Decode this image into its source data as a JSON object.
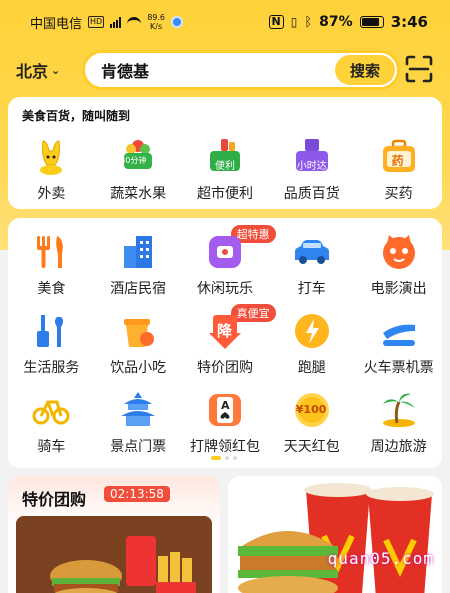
{
  "status_bar": {
    "carrier": "中国电信",
    "hd_badge": "HD",
    "net_speed_value": "89.6",
    "net_speed_unit": "K/s",
    "battery_percent": "87%",
    "battery_level": 0.87,
    "time": "3:46"
  },
  "search": {
    "city": "北京",
    "query": "肯德基",
    "button_label": "搜索"
  },
  "quick_services": {
    "slogan": "美食百货，随叫随到",
    "items": [
      {
        "label": "外卖",
        "icon": "waimai-mascot-icon"
      },
      {
        "label": "蔬菜水果",
        "icon": "vegetable-basket-icon",
        "badge": "30分钟"
      },
      {
        "label": "超市便利",
        "icon": "supermarket-basket-icon",
        "badge": "便利"
      },
      {
        "label": "品质百货",
        "icon": "quality-goods-icon",
        "badge": "小时达"
      },
      {
        "label": "买药",
        "icon": "medicine-box-icon",
        "badge": "药"
      }
    ]
  },
  "services_grid": {
    "rows": [
      [
        {
          "label": "美食",
          "icon": "food-utensils-icon"
        },
        {
          "label": "酒店民宿",
          "icon": "hotel-building-icon"
        },
        {
          "label": "休闲玩乐",
          "icon": "leisure-fun-icon",
          "tag": "超特惠"
        },
        {
          "label": "打车",
          "icon": "taxi-car-icon"
        },
        {
          "label": "电影演出",
          "icon": "movie-cat-icon"
        }
      ],
      [
        {
          "label": "生活服务",
          "icon": "life-service-tools-icon"
        },
        {
          "label": "饮品小吃",
          "icon": "drink-snack-icon"
        },
        {
          "label": "特价团购",
          "icon": "discount-group-icon",
          "tag": "真便宜",
          "icon_text": "降"
        },
        {
          "label": "跑腿",
          "icon": "errand-runner-icon"
        },
        {
          "label": "火车票机票",
          "icon": "train-plane-icon"
        }
      ],
      [
        {
          "label": "骑车",
          "icon": "bicycle-icon"
        },
        {
          "label": "景点门票",
          "icon": "temple-ticket-icon"
        },
        {
          "label": "打牌领红包",
          "icon": "playing-card-icon",
          "icon_text": "A"
        },
        {
          "label": "天天红包",
          "icon": "coin-redpacket-icon",
          "icon_text": "¥100"
        },
        {
          "label": "周边旅游",
          "icon": "palm-island-icon"
        }
      ]
    ]
  },
  "promo": {
    "title": "特价团购",
    "countdown": "02:13:58"
  },
  "watermark": "quan05.com",
  "colors": {
    "brand_yellow": "#ffd23a",
    "accent_red": "#f04e3a"
  }
}
